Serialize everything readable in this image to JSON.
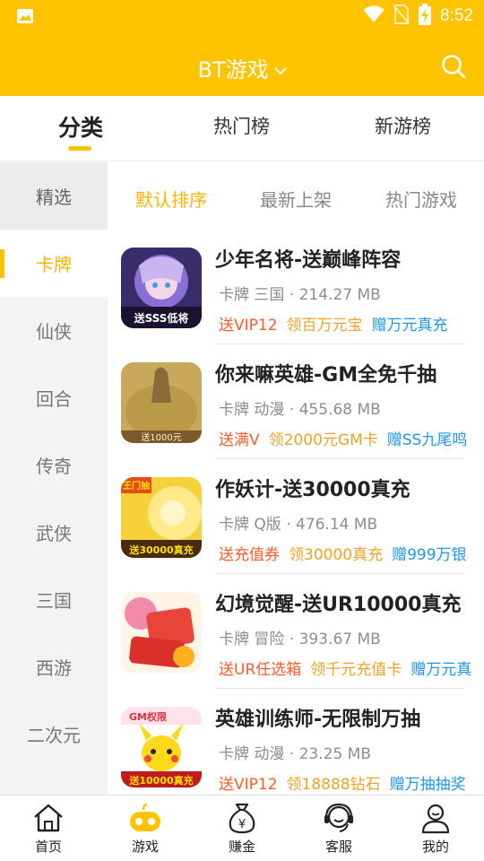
{
  "status": {
    "time": "8:52"
  },
  "header": {
    "title": "BT游戏"
  },
  "tabs": [
    {
      "label": "分类"
    },
    {
      "label": "热门榜"
    },
    {
      "label": "新游榜"
    }
  ],
  "sidebar": {
    "items": [
      {
        "label": "精选"
      },
      {
        "label": "卡牌"
      },
      {
        "label": "仙侠"
      },
      {
        "label": "回合"
      },
      {
        "label": "传奇"
      },
      {
        "label": "武侠"
      },
      {
        "label": "三国"
      },
      {
        "label": "西游"
      },
      {
        "label": "二次元"
      }
    ]
  },
  "sort_tabs": [
    {
      "label": "默认排序"
    },
    {
      "label": "最新上架"
    },
    {
      "label": "热门游戏"
    }
  ],
  "games": [
    {
      "name": "少年名将-送巅峰阵容",
      "meta": "卡牌 三国 · 214.27 MB",
      "tags": [
        "送VIP12",
        "领百万元宝",
        "赠万元真充"
      ]
    },
    {
      "name": "你来嘛英雄-GM全免千抽",
      "meta": "卡牌 动漫 · 455.68 MB",
      "tags": [
        "送满V",
        "领2000元GM卡",
        "赠SS九尾鸣"
      ]
    },
    {
      "name": "作妖计-送30000真充",
      "meta": "卡牌 Q版 · 476.14 MB",
      "tags": [
        "送充值券",
        "领30000真充",
        "赠999万银"
      ]
    },
    {
      "name": "幻境觉醒-送UR10000真充",
      "meta": "卡牌 冒险 · 393.67 MB",
      "tags": [
        "送UR任选箱",
        "领千元充值卡",
        "赠万元真"
      ]
    },
    {
      "name": "英雄训练师-无限制万抽",
      "meta": "卡牌 动漫 · 23.25 MB",
      "tags": [
        "送VIP12",
        "领18888钻石",
        "赠万抽抽奖"
      ]
    }
  ],
  "icon_text": {
    "game1": "送SSS低将",
    "game2": "送1000元",
    "game3_top": "王门抽",
    "game3_bottom": "送30000真充",
    "game5_top": "GM权限",
    "game5_bottom": "送10000真充"
  },
  "bottom_nav": [
    {
      "label": "首页",
      "icon": "home-icon"
    },
    {
      "label": "游戏",
      "icon": "gamepad-icon"
    },
    {
      "label": "赚金",
      "icon": "money-bag-icon"
    },
    {
      "label": "客服",
      "icon": "headset-icon"
    },
    {
      "label": "我的",
      "icon": "user-icon"
    }
  ],
  "colors": {
    "brand": "#FFC300",
    "tag_red": "#FF5A28",
    "tag_orange": "#F2A126",
    "tag_blue": "#1E96E8"
  }
}
